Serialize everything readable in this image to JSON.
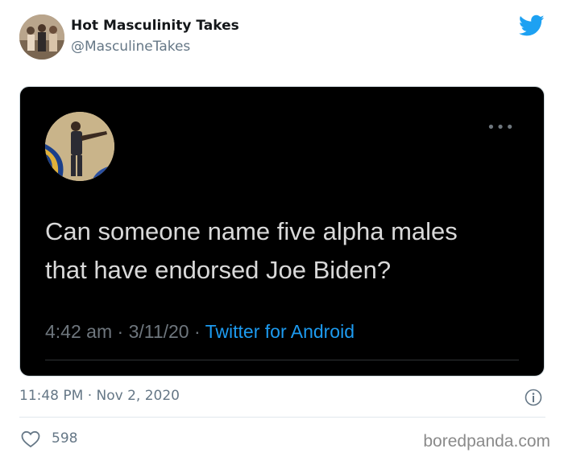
{
  "account": {
    "display_name": "Hot Masculinity Takes",
    "handle": "@MasculineTakes"
  },
  "embedded_tweet": {
    "text_line1": "Can someone name five alpha males",
    "text_line2": "that have endorsed Joe Biden?",
    "time": "4:42 am",
    "date": "3/11/20",
    "separator": "·",
    "source": "Twitter for Android"
  },
  "tweet": {
    "timestamp": "11:48 PM · Nov 2, 2020",
    "likes": "598"
  },
  "watermark": "boredpanda.com",
  "colors": {
    "twitter_blue": "#1da1f2",
    "dark_card": "#000000",
    "muted_text": "#657786"
  },
  "icons": {
    "brand": "twitter-bird-icon",
    "more": "more-dots-icon",
    "info": "info-icon",
    "like": "heart-icon"
  }
}
